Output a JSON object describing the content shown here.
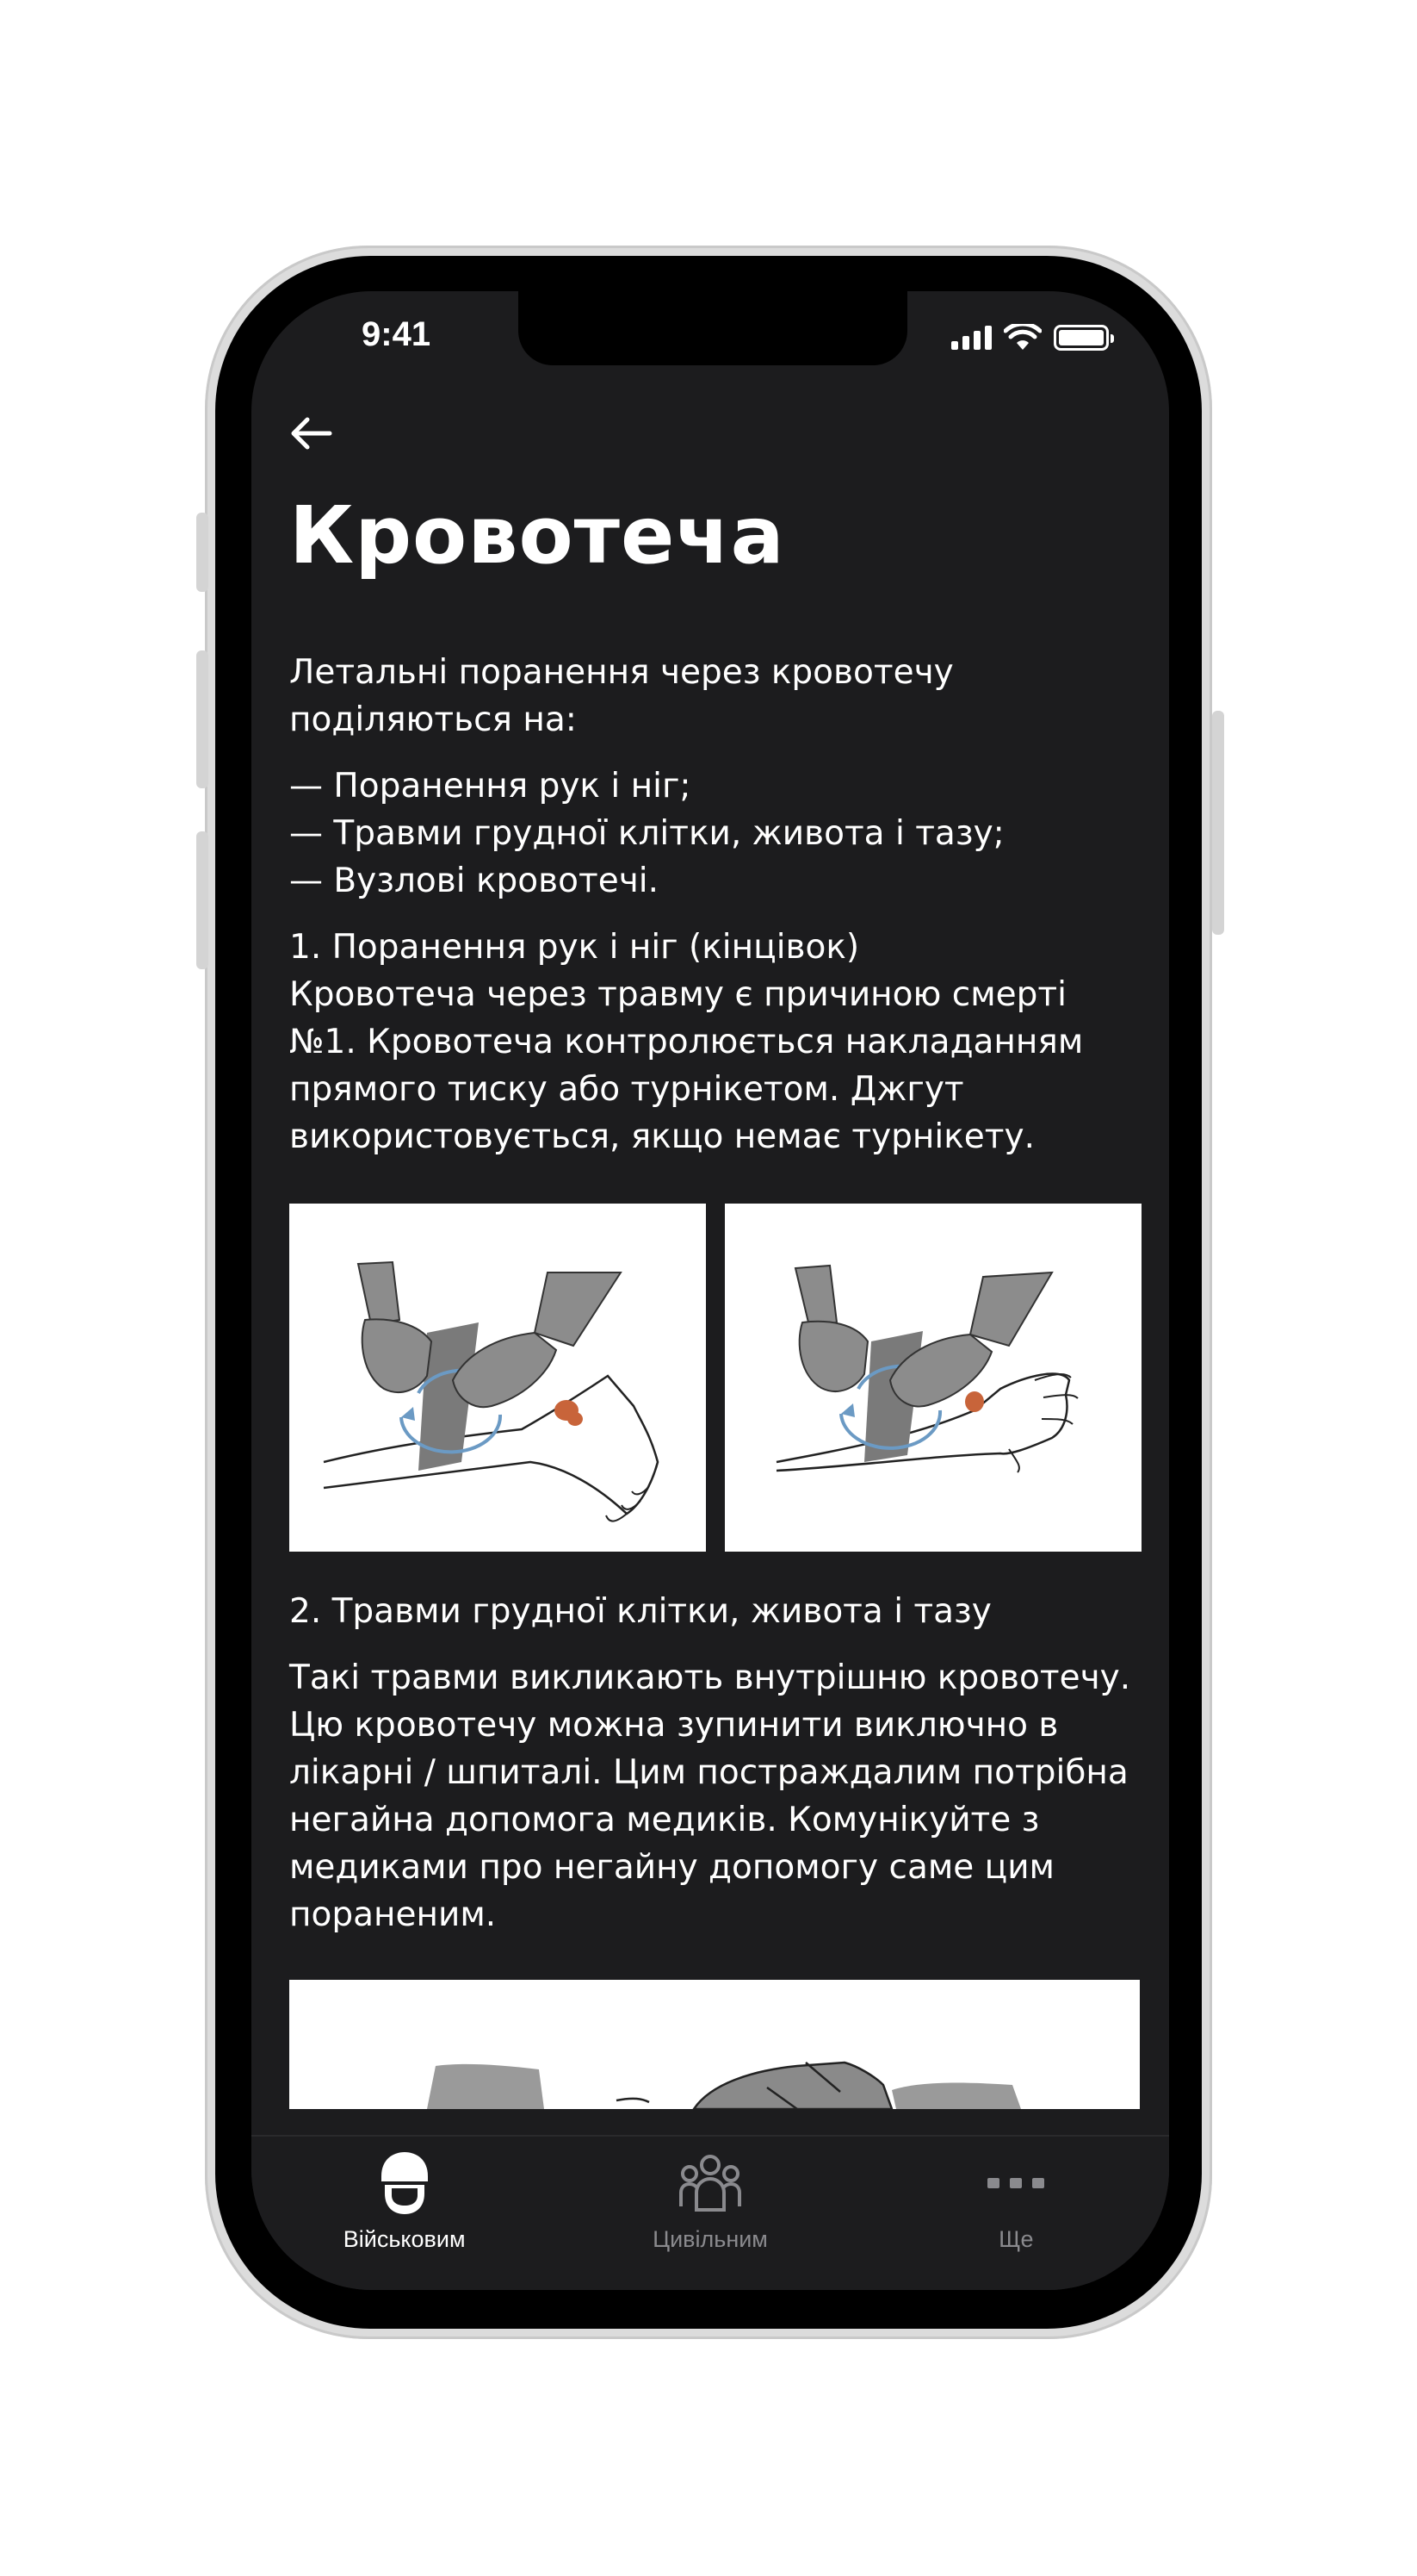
{
  "status_bar": {
    "time": "9:41"
  },
  "header": {
    "back_icon": "arrow-left-icon",
    "title": "Кровотеча"
  },
  "article": {
    "intro": "Летальні поранення через кровотечу поділяються на:",
    "list": "— Поранення рук і ніг;\n— Травми грудної клітки, живота і тазу;\n— Вузлові кровотечі.",
    "section1": "1. Поранення рук і ніг (кінцівок)\nКровотеча через травму є причиною смерті №1. Кровотеча контролюється накладанням прямого тиску або турнікетом. Джгут використовується, якщо немає турнікету.",
    "section2_heading": "2. Травми грудної клітки, живота і тазу",
    "section2_body": "Такі травми викликають внутрішню кровотечу.\nЦю кровотечу можна зупинити виключно в лікарні / шпиталі. Цим постраждалим потрібна негайна допомога медиків. Комунікуйте з медиками про негайну допомогу саме цим пораненим."
  },
  "illustrations": [
    {
      "icon": "tourniquet-leg-illustration"
    },
    {
      "icon": "tourniquet-arm-illustration"
    },
    {
      "icon": "torso-injury-illustration"
    }
  ],
  "tab_bar": {
    "tabs": [
      {
        "label": "Військовим",
        "icon": "soldier-helmet-icon",
        "active": true
      },
      {
        "label": "Цивільним",
        "icon": "people-group-icon",
        "active": false
      },
      {
        "label": "Ще",
        "icon": "more-dots-icon",
        "active": false
      }
    ]
  },
  "colors": {
    "screen_background": "#1c1c1e",
    "text_primary": "#ffffff",
    "text_inactive": "#8a8a8e",
    "wound": "#c8643a",
    "arrow_accent": "#6b9ac4"
  }
}
